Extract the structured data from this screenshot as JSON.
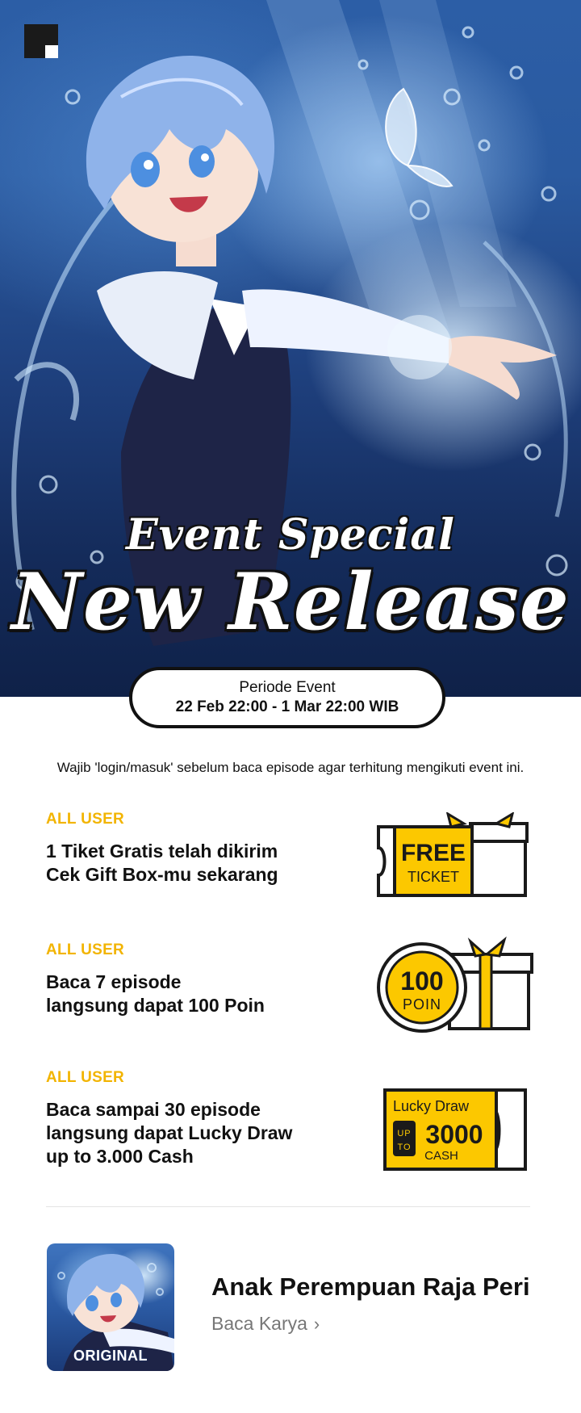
{
  "hero": {
    "subtitle": "Event Special",
    "title": "New Release"
  },
  "period": {
    "label": "Periode Event",
    "dates": "22 Feb 22:00 - 1 Mar 22:00 WIB"
  },
  "notice": "Wajib 'login/masuk' sebelum baca episode agar terhitung mengikuti event ini.",
  "rewards": [
    {
      "tag": "ALL USER",
      "lines": [
        "1 Tiket Gratis telah dikirim",
        "Cek Gift Box-mu sekarang"
      ],
      "icon": "free-ticket-gift-icon",
      "icon_text": [
        "FREE",
        "TICKET"
      ]
    },
    {
      "tag": "ALL USER",
      "lines": [
        "Baca 7 episode",
        "langsung dapat 100 Poin"
      ],
      "icon": "point-coin-gift-icon",
      "icon_text": [
        "100",
        "POIN"
      ]
    },
    {
      "tag": "ALL USER",
      "lines": [
        "Baca sampai 30 episode",
        "langsung dapat Lucky Draw",
        "up to 3.000 Cash"
      ],
      "icon": "lucky-draw-ticket-icon",
      "icon_text": [
        "Lucky Draw",
        "UP",
        "TO",
        "3000",
        "CASH"
      ]
    }
  ],
  "series": {
    "badge": "ORIGINAL",
    "title": "Anak Perempuan Raja Peri",
    "link": "Baca Karya",
    "link_icon": "chevron-right-icon"
  },
  "colors": {
    "accent_yellow": "#f2b400",
    "icon_yellow": "#fcc800",
    "ink": "#111111",
    "hero_blue": "#2a5aa0"
  }
}
